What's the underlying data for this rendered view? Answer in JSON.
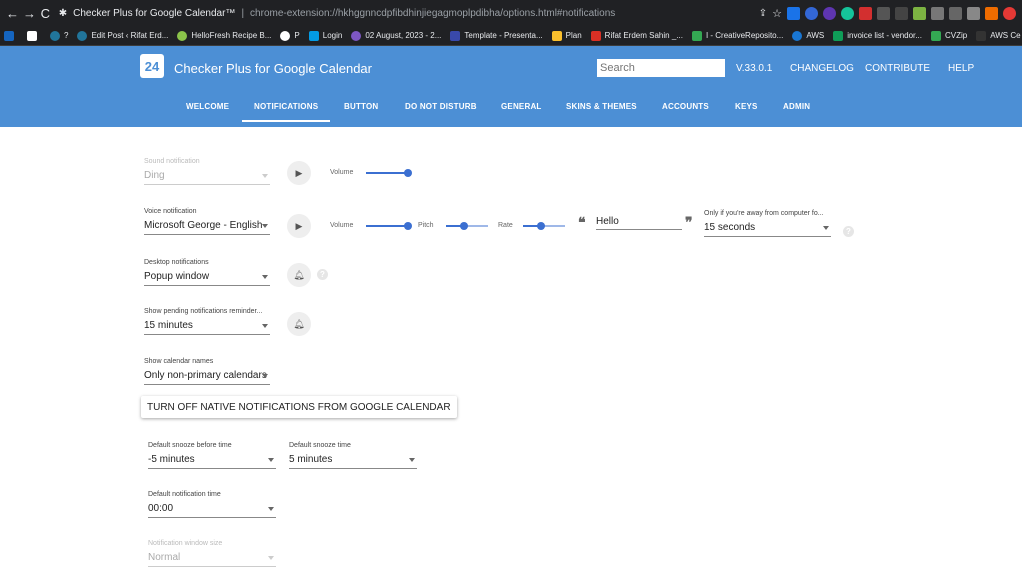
{
  "browser": {
    "tab_title": "Checker Plus for Google Calendar™",
    "url": "chrome-extension://hkhggnncdpfibdhinjiegagmoplpdibha/options.html#notifications",
    "bookmarks": [
      "",
      "",
      "?",
      "Edit Post ‹ Rifat Erd...",
      "HelloFresh Recipe B...",
      "P",
      "Login",
      "02 August, 2023 - 2...",
      "Template - Presenta...",
      "Plan",
      "Rifat Erdem Sahin _...",
      "I - CreativeReposito...",
      "AWS",
      "invoice list - vendor...",
      "CVZip",
      "AWS Ce"
    ]
  },
  "header": {
    "logo_text": "24",
    "title": "Checker Plus for Google Calendar",
    "search_placeholder": "Search",
    "version": "V.33.0.1",
    "links": [
      "CHANGELOG",
      "CONTRIBUTE",
      "HELP"
    ]
  },
  "tabs": [
    "WELCOME",
    "NOTIFICATIONS",
    "BUTTON",
    "DO NOT DISTURB",
    "GENERAL",
    "SKINS & THEMES",
    "ACCOUNTS",
    "KEYS",
    "ADMIN"
  ],
  "active_tab": "NOTIFICATIONS",
  "settings": {
    "sound_label": "Sound notification",
    "sound_value": "Ding",
    "volume_label": "Volume",
    "volume_level": 1.0,
    "voice_label": "Voice notification",
    "voice_value": "Microsoft George - English",
    "pitch_label": "Pitch",
    "pitch_level": 0.42,
    "rate_label": "Rate",
    "rate_level": 0.42,
    "voice_volume_level": 1.0,
    "voice_text": "Hello",
    "away_label": "Only if you're away from computer fo...",
    "away_value": "15 seconds",
    "desktop_label": "Desktop notifications",
    "desktop_value": "Popup window",
    "pending_label": "Show pending notifications reminder...",
    "pending_value": "15 minutes",
    "calnames_label": "Show calendar names",
    "calnames_value": "Only non-primary calendars",
    "native_off_button": "TURN OFF NATIVE NOTIFICATIONS FROM GOOGLE CALENDAR",
    "snooze_before_label": "Default snooze before time",
    "snooze_before_value": "-5 minutes",
    "snooze_label": "Default snooze time",
    "snooze_value": "5 minutes",
    "notif_time_label": "Default notification time",
    "notif_time_value": "00:00",
    "window_size_label": "Notification window size",
    "window_size_value": "Normal"
  }
}
